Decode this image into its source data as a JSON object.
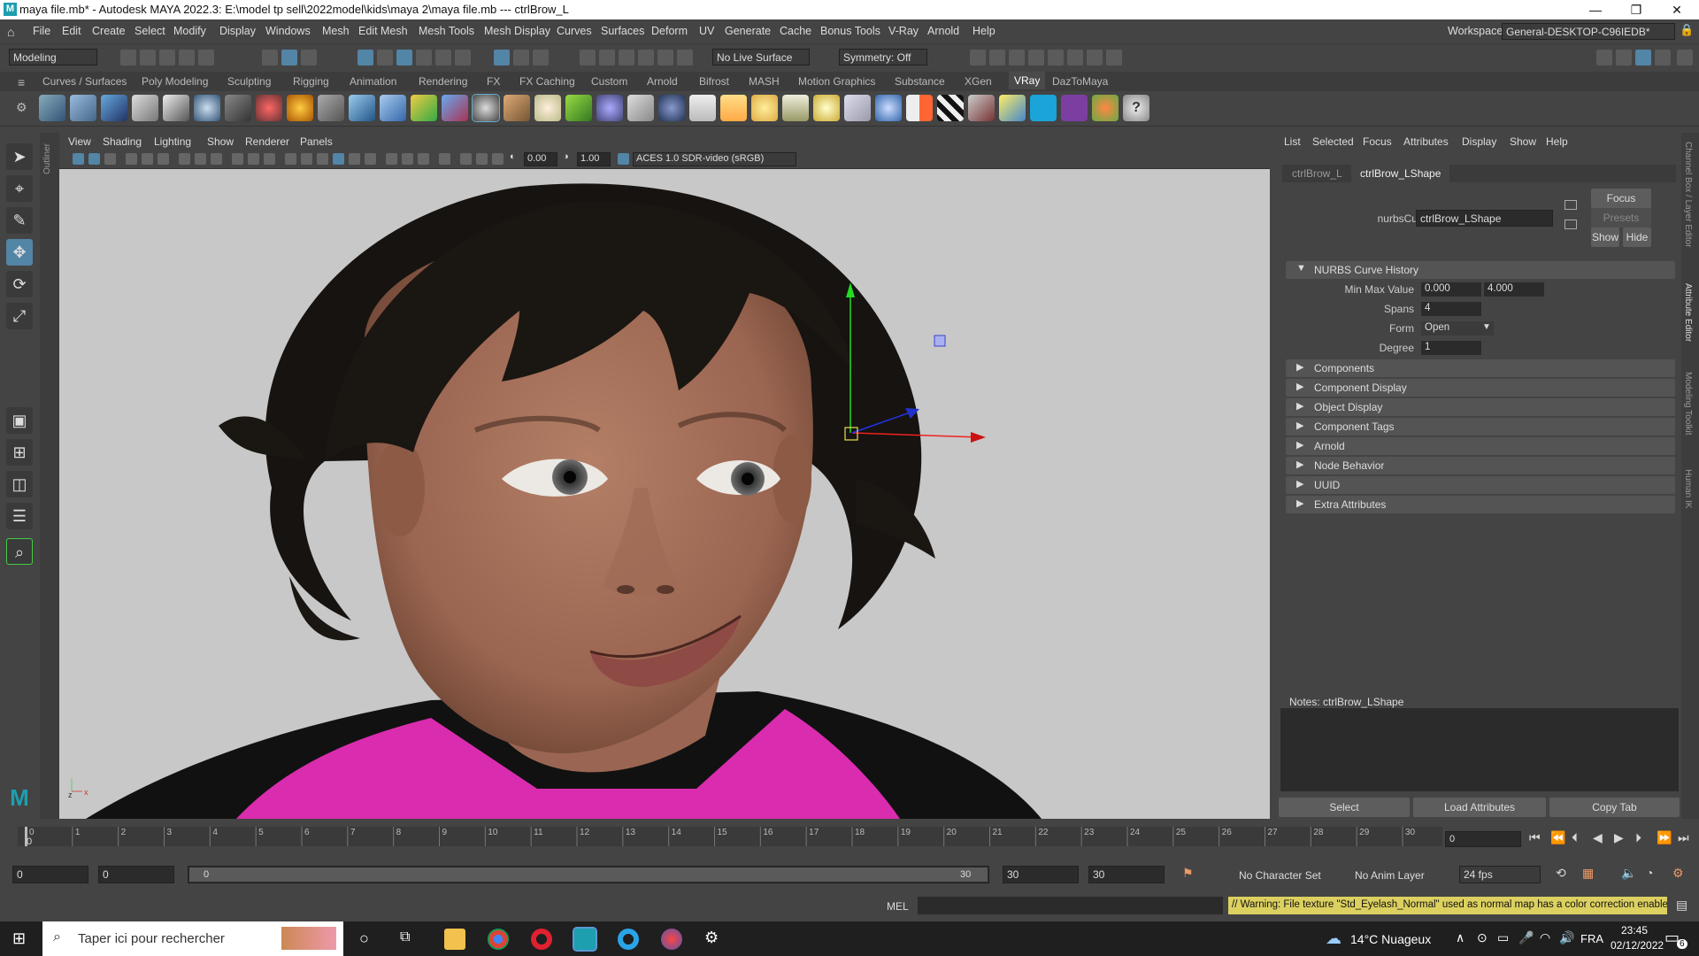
{
  "window": {
    "title": "maya file.mb* - Autodesk MAYA 2022.3: E:\\model tp sell\\2022model\\kids\\maya 2\\maya file.mb   ---   ctrlBrow_L",
    "minimize": "—",
    "maximize": "❐",
    "close": "✕"
  },
  "menubar": {
    "items": [
      "File",
      "Edit",
      "Create",
      "Select",
      "Modify",
      "Display",
      "Windows",
      "Mesh",
      "Edit Mesh",
      "Mesh Tools",
      "Mesh Display",
      "Curves",
      "Surfaces",
      "Deform",
      "UV",
      "Generate",
      "Cache",
      "Bonus Tools",
      "V-Ray",
      "Arnold",
      "Help"
    ],
    "workspace_label": "Workspace:",
    "workspace_value": "General-DESKTOP-C96IEDB*"
  },
  "statusline": {
    "mode": "Modeling",
    "live_surface": "No Live Surface",
    "symmetry": "Symmetry: Off"
  },
  "shelf": {
    "tabs": [
      "Curves / Surfaces",
      "Poly Modeling",
      "Sculpting",
      "Rigging",
      "Animation",
      "Rendering",
      "FX",
      "FX Caching",
      "Custom",
      "Arnold",
      "Bifrost",
      "MASH",
      "Motion Graphics",
      "Substance",
      "XGen",
      "VRay",
      "DazToMaya"
    ],
    "active_tab": "VRay"
  },
  "viewport": {
    "menu": [
      "View",
      "Shading",
      "Lighting",
      "Show",
      "Renderer",
      "Panels"
    ],
    "exposure": "0.00",
    "gamma": "1.00",
    "colorspace": "ACES 1.0 SDR-video (sRGB)"
  },
  "attribute_editor": {
    "menu": [
      "List",
      "Selected",
      "Focus",
      "Attributes",
      "Display",
      "Show",
      "Help"
    ],
    "tabs": [
      "ctrlBrow_L",
      "ctrlBrow_LShape"
    ],
    "node_type_label": "nurbsCurve:",
    "node_name": "ctrlBrow_LShape",
    "focus_btn": "Focus",
    "presets_btn": "Presets",
    "show_btn": "Show",
    "hide_btn": "Hide",
    "history_section": "NURBS Curve History",
    "min_max_label": "Min Max Value",
    "min_value": "0.000",
    "max_value": "4.000",
    "spans_label": "Spans",
    "spans_value": "4",
    "form_label": "Form",
    "form_value": "Open",
    "degree_label": "Degree",
    "degree_value": "1",
    "sections": [
      "Components",
      "Component Display",
      "Object Display",
      "Component Tags",
      "Arnold",
      "Node Behavior",
      "UUID",
      "Extra Attributes"
    ],
    "notes_label": "Notes:  ctrlBrow_LShape",
    "select_btn": "Select",
    "load_btn": "Load Attributes",
    "copy_btn": "Copy Tab"
  },
  "side_strip": [
    "Channel Box / Layer Editor",
    "Attribute Editor",
    "Modeling Toolkit",
    "Human IK"
  ],
  "outliner_label": "Outliner",
  "timeline": {
    "ticks": [
      "0",
      "1",
      "2",
      "3",
      "4",
      "5",
      "6",
      "7",
      "8",
      "9",
      "10",
      "11",
      "12",
      "13",
      "14",
      "15",
      "16",
      "17",
      "18",
      "19",
      "20",
      "21",
      "22",
      "23",
      "24",
      "25",
      "26",
      "27",
      "28",
      "29",
      "30"
    ],
    "current_frame_marker": "0",
    "current_frame": "0"
  },
  "range": {
    "start": "0",
    "anim_start": "0",
    "range_start": "0",
    "range_end": "30",
    "anim_end": "30",
    "end": "30",
    "character_set": "No Character Set",
    "anim_layer": "No Anim Layer",
    "fps": "24 fps"
  },
  "command": {
    "lang": "MEL",
    "warning": "// Warning: File texture \"Std_Eyelash_Normal\" used as normal map has a color correction enable"
  },
  "taskbar": {
    "search_placeholder": "Taper ici pour rechercher",
    "weather": "14°C  Nuageux",
    "lang": "FRA",
    "time": "23:45",
    "date": "02/12/2022",
    "notif_count": "6"
  }
}
